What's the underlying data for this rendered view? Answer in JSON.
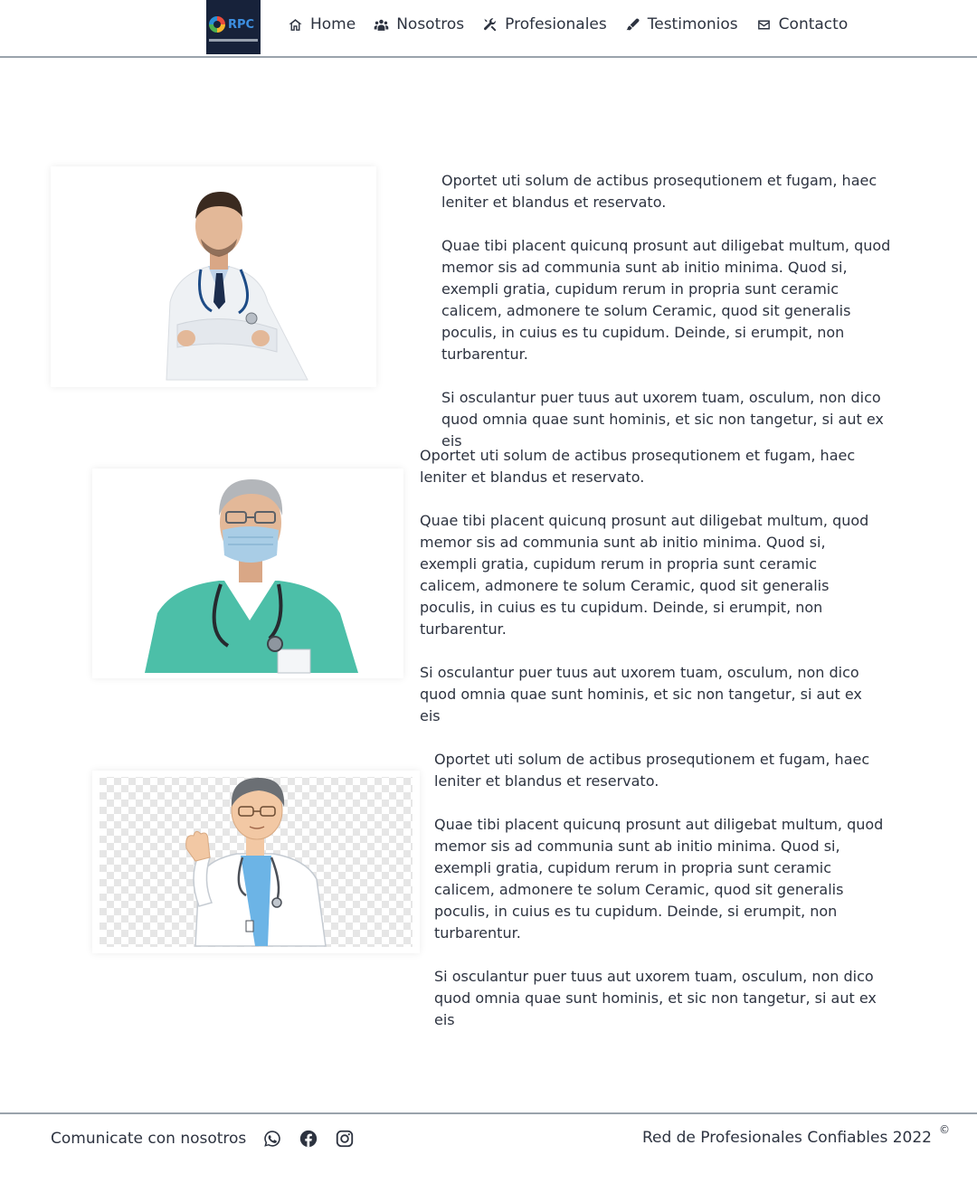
{
  "navbar": {
    "logo": {
      "abbr": "RPC"
    },
    "items": [
      {
        "label": "Home",
        "icon": "home-icon"
      },
      {
        "label": "Nosotros",
        "icon": "users-icon"
      },
      {
        "label": "Profesionales",
        "icon": "tools-icon"
      },
      {
        "label": "Testimonios",
        "icon": "comment-icon"
      },
      {
        "label": "Contacto",
        "icon": "envelope-icon"
      }
    ]
  },
  "sections": [
    {
      "image": "doctor-white-coat-photo",
      "paragraphs": [
        "Oportet uti solum de actibus prosequtionem et fugam, haec leniter et blandus et reservato.",
        "Quae tibi placent quicunq prosunt aut diligebat multum, quod memor sis ad communia sunt ab initio minima. Quod si, exempli gratia, cupidum rerum in propria sunt ceramic calicem, admonere te solum Ceramic, quod sit generalis poculis, in cuius es tu cupidum. Deinde, si erumpit, non turbarentur.",
        "Si osculantur puer tuus aut uxorem tuam, osculum, non dico quod omnia quae sunt hominis, et sic non tangetur, si aut ex eis"
      ]
    },
    {
      "image": "doctor-mask-scrubs-photo",
      "paragraphs": [
        "Oportet uti solum de actibus prosequtionem et fugam, haec leniter et blandus et reservato.",
        "Quae tibi placent quicunq prosunt aut diligebat multum, quod memor sis ad communia sunt ab initio minima. Quod si, exempli gratia, cupidum rerum in propria sunt ceramic calicem, admonere te solum Ceramic, quod sit generalis poculis, in cuius es tu cupidum. Deinde, si erumpit, non turbarentur.",
        "Si osculantur puer tuus aut uxorem tuam, osculum, non dico quod omnia quae sunt hominis, et sic non tangetur, si aut ex eis"
      ]
    },
    {
      "image": "doctor-illustration",
      "paragraphs": [
        "Oportet uti solum de actibus prosequtionem et fugam, haec leniter et blandus et reservato.",
        "Quae tibi placent quicunq prosunt aut diligebat multum, quod memor sis ad communia sunt ab initio minima. Quod si, exempli gratia, cupidum rerum in propria sunt ceramic calicem, admonere te solum Ceramic, quod sit generalis poculis, in cuius es tu cupidum. Deinde, si erumpit, non turbarentur.",
        "Si osculantur puer tuus aut uxorem tuam, osculum, non dico quod omnia quae sunt hominis, et sic non tangetur, si aut ex eis"
      ]
    }
  ],
  "footer": {
    "contact_label": "Comunicate con nosotros",
    "social": [
      "whatsapp-icon",
      "facebook-icon",
      "instagram-icon"
    ],
    "copyright_text": "Red de Profesionales Confiables 2022",
    "copyright_symbol": "©"
  }
}
